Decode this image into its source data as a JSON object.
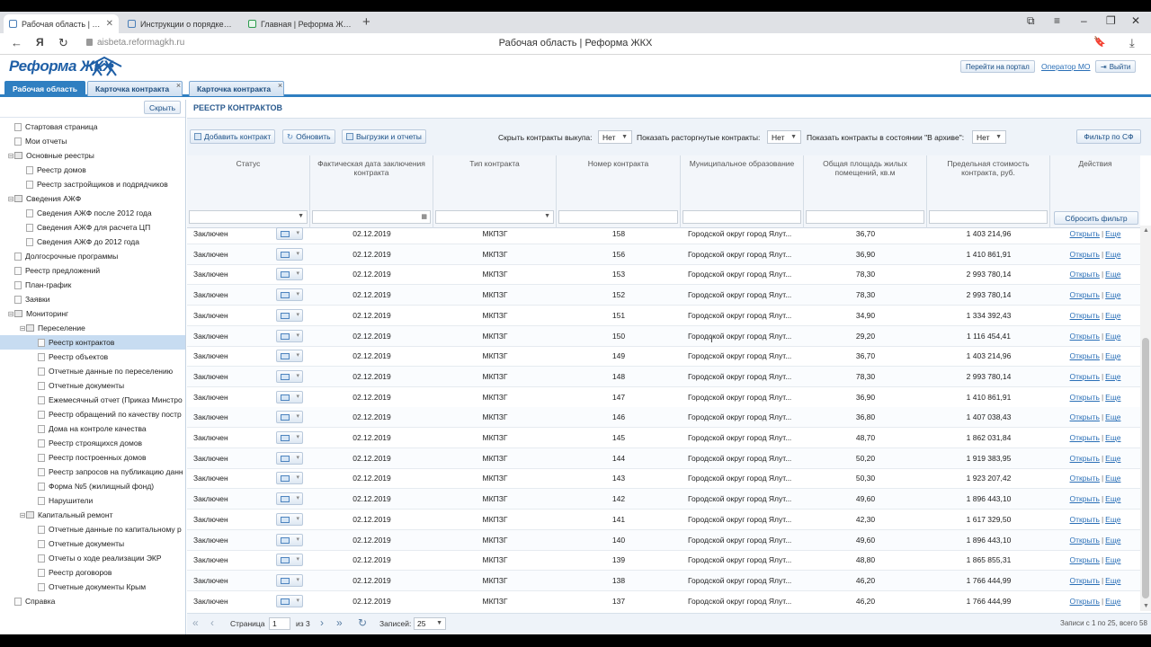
{
  "browser": {
    "tabs": [
      {
        "title": "Рабочая область | Рефо",
        "active": true
      },
      {
        "title": "Инструкции о порядке со",
        "active": false
      },
      {
        "title": "Главная | Реформа ЖКХ",
        "active": false
      }
    ],
    "url": "aisbeta.reformagkh.ru",
    "page_title": "Рабочая область | Реформа ЖКХ"
  },
  "header": {
    "logo_text": "Реформа ЖКХ",
    "portal_button": "Перейти на портал",
    "operator_link": "Оператор МО",
    "logout_button": "Выйти"
  },
  "main_tabs": [
    {
      "label": "Рабочая область",
      "active": true
    },
    {
      "label": "Карточка контракта",
      "active": false
    },
    {
      "label": "Карточка контракта",
      "active": false
    }
  ],
  "sidebar": {
    "hide_button": "Скрыть",
    "items": [
      {
        "label": "Стартовая страница",
        "level": 0,
        "type": "leaf"
      },
      {
        "label": "Мои отчеты",
        "level": 0,
        "type": "leaf"
      },
      {
        "label": "Основные реестры",
        "level": 0,
        "type": "folder"
      },
      {
        "label": "Реестр домов",
        "level": 1,
        "type": "leaf"
      },
      {
        "label": "Реестр застройщиков и подрядчиков",
        "level": 1,
        "type": "leaf"
      },
      {
        "label": "Сведения АЖФ",
        "level": 0,
        "type": "folder"
      },
      {
        "label": "Сведения АЖФ после 2012 года",
        "level": 1,
        "type": "leaf"
      },
      {
        "label": "Сведения АЖФ для расчета ЦП",
        "level": 1,
        "type": "leaf"
      },
      {
        "label": "Сведения АЖФ до 2012 года",
        "level": 1,
        "type": "leaf"
      },
      {
        "label": "Долгосрочные программы",
        "level": 0,
        "type": "leaf"
      },
      {
        "label": "Реестр предложений",
        "level": 0,
        "type": "leaf"
      },
      {
        "label": "План-график",
        "level": 0,
        "type": "leaf"
      },
      {
        "label": "Заявки",
        "level": 0,
        "type": "leaf"
      },
      {
        "label": "Мониторинг",
        "level": 0,
        "type": "folder"
      },
      {
        "label": "Переселение",
        "level": 1,
        "type": "folder"
      },
      {
        "label": "Реестр контрактов",
        "level": 2,
        "type": "leaf",
        "selected": true
      },
      {
        "label": "Реестр объектов",
        "level": 2,
        "type": "leaf"
      },
      {
        "label": "Отчетные данные по переселению",
        "level": 2,
        "type": "leaf"
      },
      {
        "label": "Отчетные документы",
        "level": 2,
        "type": "leaf"
      },
      {
        "label": "Ежемесячный отчет (Приказ Минстро",
        "level": 2,
        "type": "leaf"
      },
      {
        "label": "Реестр обращений по качеству постр",
        "level": 2,
        "type": "leaf"
      },
      {
        "label": "Дома на контроле качества",
        "level": 2,
        "type": "leaf"
      },
      {
        "label": "Реестр строящихся домов",
        "level": 2,
        "type": "leaf"
      },
      {
        "label": "Реестр построенных домов",
        "level": 2,
        "type": "leaf"
      },
      {
        "label": "Реестр запросов на публикацию данн",
        "level": 2,
        "type": "leaf"
      },
      {
        "label": "Форма №5 (жилищный фонд)",
        "level": 2,
        "type": "leaf"
      },
      {
        "label": "Нарушители",
        "level": 2,
        "type": "leaf"
      },
      {
        "label": "Капитальный ремонт",
        "level": 1,
        "type": "folder"
      },
      {
        "label": "Отчетные данные по капитальному р",
        "level": 2,
        "type": "leaf"
      },
      {
        "label": "Отчетные документы",
        "level": 2,
        "type": "leaf"
      },
      {
        "label": "Отчеты о ходе реализации ЭКР",
        "level": 2,
        "type": "leaf"
      },
      {
        "label": "Реестр договоров",
        "level": 2,
        "type": "leaf"
      },
      {
        "label": "Отчетные документы Крым",
        "level": 2,
        "type": "leaf"
      },
      {
        "label": "Справка",
        "level": 0,
        "type": "leaf"
      }
    ]
  },
  "registry": {
    "title": "РЕЕСТР КОНТРАКТОВ",
    "toolbar": {
      "add_button": "Добавить контракт",
      "refresh_button": "Обновить",
      "export_button": "Выгрузки и отчеты",
      "hide_buyout_label": "Скрыть контракты выкупа:",
      "hide_buyout_value": "Нет",
      "show_terminated_label": "Показать расторгнутые контракты:",
      "show_terminated_value": "Нет",
      "show_archived_label": "Показать контракты в состоянии \"В архиве\":",
      "show_archived_value": "Нет",
      "filter_button": "Фильтр по СФ"
    },
    "columns": [
      "Статус",
      "Фактическая дата заключения контракта",
      "Тип контракта",
      "Номер контракта",
      "Муниципальное образование",
      "Общая площадь жилых помещений, кв.м",
      "Предельная стоимость контракта, руб.",
      "Действия"
    ],
    "reset_filter_button": "Сбросить фильтр",
    "open_link": "Открыть",
    "more_link": "Еще",
    "rows": [
      {
        "status": "Заключен",
        "date": "02.12.2019",
        "type": "МКПЗГ",
        "number": "158",
        "municipality": "Городской округ город Ялут...",
        "area": "36,70",
        "cost": "1 403 214,96"
      },
      {
        "status": "Заключен",
        "date": "02.12.2019",
        "type": "МКПЗГ",
        "number": "156",
        "municipality": "Городской округ город Ялут...",
        "area": "36,90",
        "cost": "1 410 861,91"
      },
      {
        "status": "Заключен",
        "date": "02.12.2019",
        "type": "МКПЗГ",
        "number": "153",
        "municipality": "Городской округ город Ялут...",
        "area": "78,30",
        "cost": "2 993 780,14"
      },
      {
        "status": "Заключен",
        "date": "02.12.2019",
        "type": "МКПЗГ",
        "number": "152",
        "municipality": "Городской округ город Ялут...",
        "area": "78,30",
        "cost": "2 993 780,14"
      },
      {
        "status": "Заключен",
        "date": "02.12.2019",
        "type": "МКПЗГ",
        "number": "151",
        "municipality": "Городской округ город Ялут...",
        "area": "34,90",
        "cost": "1 334 392,43"
      },
      {
        "status": "Заключен",
        "date": "02.12.2019",
        "type": "МКПЗГ",
        "number": "150",
        "municipality": "Городской округ город Ялут...",
        "area": "29,20",
        "cost": "1 116 454,41"
      },
      {
        "status": "Заключен",
        "date": "02.12.2019",
        "type": "МКПЗГ",
        "number": "149",
        "municipality": "Городской округ город Ялут...",
        "area": "36,70",
        "cost": "1 403 214,96"
      },
      {
        "status": "Заключен",
        "date": "02.12.2019",
        "type": "МКПЗГ",
        "number": "148",
        "municipality": "Городской округ город Ялут...",
        "area": "78,30",
        "cost": "2 993 780,14"
      },
      {
        "status": "Заключен",
        "date": "02.12.2019",
        "type": "МКПЗГ",
        "number": "147",
        "municipality": "Городской округ город Ялут...",
        "area": "36,90",
        "cost": "1 410 861,91"
      },
      {
        "status": "Заключен",
        "date": "02.12.2019",
        "type": "МКПЗГ",
        "number": "146",
        "municipality": "Городской округ город Ялут...",
        "area": "36,80",
        "cost": "1 407 038,43"
      },
      {
        "status": "Заключен",
        "date": "02.12.2019",
        "type": "МКПЗГ",
        "number": "145",
        "municipality": "Городской округ город Ялут...",
        "area": "48,70",
        "cost": "1 862 031,84"
      },
      {
        "status": "Заключен",
        "date": "02.12.2019",
        "type": "МКПЗГ",
        "number": "144",
        "municipality": "Городской округ город Ялут...",
        "area": "50,20",
        "cost": "1 919 383,95"
      },
      {
        "status": "Заключен",
        "date": "02.12.2019",
        "type": "МКПЗГ",
        "number": "143",
        "municipality": "Городской округ город Ялут...",
        "area": "50,30",
        "cost": "1 923 207,42"
      },
      {
        "status": "Заключен",
        "date": "02.12.2019",
        "type": "МКПЗГ",
        "number": "142",
        "municipality": "Городской округ город Ялут...",
        "area": "49,60",
        "cost": "1 896 443,10"
      },
      {
        "status": "Заключен",
        "date": "02.12.2019",
        "type": "МКПЗГ",
        "number": "141",
        "municipality": "Городской округ город Ялут...",
        "area": "42,30",
        "cost": "1 617 329,50"
      },
      {
        "status": "Заключен",
        "date": "02.12.2019",
        "type": "МКПЗГ",
        "number": "140",
        "municipality": "Городской округ город Ялут...",
        "area": "49,60",
        "cost": "1 896 443,10"
      },
      {
        "status": "Заключен",
        "date": "02.12.2019",
        "type": "МКПЗГ",
        "number": "139",
        "municipality": "Городской округ город Ялут...",
        "area": "48,80",
        "cost": "1 865 855,31"
      },
      {
        "status": "Заключен",
        "date": "02.12.2019",
        "type": "МКПЗГ",
        "number": "138",
        "municipality": "Городской округ город Ялут...",
        "area": "46,20",
        "cost": "1 766 444,99"
      },
      {
        "status": "Заключен",
        "date": "02.12.2019",
        "type": "МКПЗГ",
        "number": "137",
        "municipality": "Городской округ город Ялут...",
        "area": "46,20",
        "cost": "1 766 444,99"
      }
    ]
  },
  "pager": {
    "page_label": "Страница",
    "page_value": "1",
    "of_label": "из 3",
    "records_label": "Записей:",
    "records_value": "25",
    "summary": "Записи с 1 по 25, всего 58"
  },
  "colors": {
    "accent": "#2f7fc1",
    "link": "#2a6fb7",
    "selected_row": "#c7dcf1"
  }
}
